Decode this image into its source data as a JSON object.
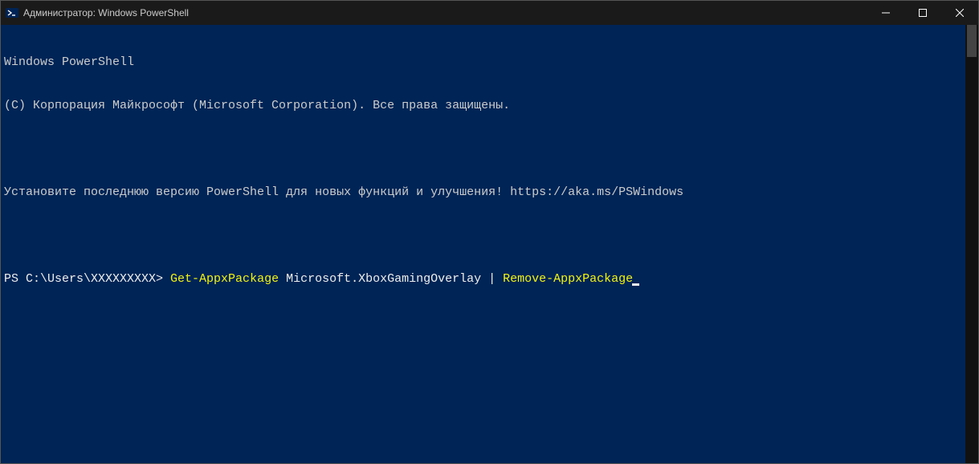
{
  "window": {
    "title": "Администратор: Windows PowerShell"
  },
  "terminal": {
    "header1": "Windows PowerShell",
    "header2": "(C) Корпорация Майкрософт (Microsoft Corporation). Все права защищены.",
    "notice": "Установите последнюю версию PowerShell для новых функций и улучшения! https://aka.ms/PSWindows",
    "prompt": "PS C:\\Users\\XXXXXXXXX> ",
    "cmd_get": "Get-AppxPackage",
    "cmd_arg": " Microsoft.XboxGamingOverlay ",
    "cmd_pipe": "|",
    "cmd_remove": " Remove-AppxPackage"
  }
}
